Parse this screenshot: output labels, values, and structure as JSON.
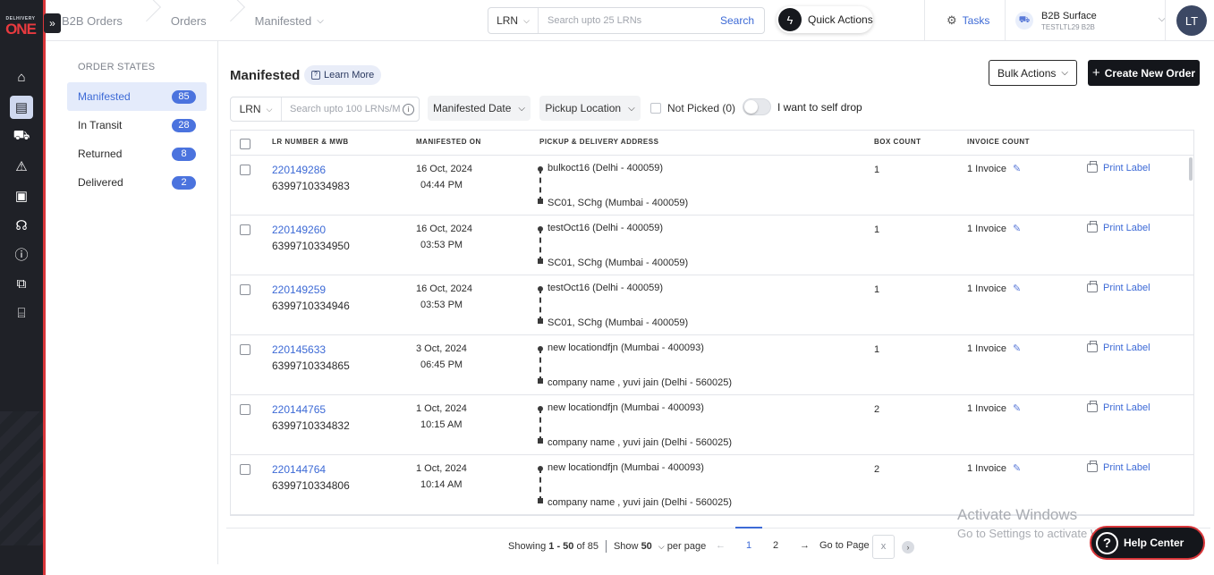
{
  "brand": {
    "small": "DELHIVERY",
    "big": "ONE"
  },
  "rail": {
    "icons": [
      "home-icon",
      "orders-icon",
      "truck-icon",
      "warning-icon",
      "payments-icon",
      "support-icon",
      "info-icon",
      "apps-icon",
      "warehouse-icon"
    ],
    "active_index": 1
  },
  "breadcrumb": [
    "B2B Orders",
    "Orders",
    "Manifested"
  ],
  "search": {
    "type": "LRN",
    "placeholder": "Search upto 25 LRNs",
    "button": "Search"
  },
  "quick_actions": "Quick Actions",
  "tasks": "Tasks",
  "account": {
    "name": "B2B Surface",
    "sub": "TESTLTL29 B2B",
    "avatar": "LT"
  },
  "order_states": {
    "title": "ORDER STATES",
    "items": [
      {
        "label": "Manifested",
        "count": "85"
      },
      {
        "label": "In Transit",
        "count": "28"
      },
      {
        "label": "Returned",
        "count": "8"
      },
      {
        "label": "Delivered",
        "count": "2"
      }
    ]
  },
  "page": {
    "title": "Manifested",
    "learn_more": "Learn More",
    "bulk_actions": "Bulk Actions",
    "create_order": "Create New Order"
  },
  "filters": {
    "lrn_type": "LRN",
    "lrn_placeholder": "Search upto 100 LRNs/M",
    "manifested_date": "Manifested Date",
    "pickup_location": "Pickup Location",
    "not_picked": "Not Picked (0)",
    "self_drop": "I want to self drop"
  },
  "table": {
    "headers": {
      "lr": "LR NUMBER & MWB",
      "manifested": "MANIFESTED ON",
      "address": "PICKUP & DELIVERY ADDRESS",
      "box": "BOX COUNT",
      "invoice": "INVOICE COUNT"
    },
    "rows": [
      {
        "lrn": "220149286",
        "mwb": "6399710334983",
        "date": "16 Oct, 2024",
        "time": "04:44 PM",
        "pickup": "bulkoct16 (Delhi - 400059)",
        "delivery": "SC01, SChg (Mumbai - 400059)",
        "box": "1",
        "invoice": "1 Invoice",
        "print": "Print Label"
      },
      {
        "lrn": "220149260",
        "mwb": "6399710334950",
        "date": "16 Oct, 2024",
        "time": "03:53 PM",
        "pickup": "testOct16 (Delhi - 400059)",
        "delivery": "SC01, SChg (Mumbai - 400059)",
        "box": "1",
        "invoice": "1 Invoice",
        "print": "Print Label"
      },
      {
        "lrn": "220149259",
        "mwb": "6399710334946",
        "date": "16 Oct, 2024",
        "time": "03:53 PM",
        "pickup": "testOct16 (Delhi - 400059)",
        "delivery": "SC01, SChg (Mumbai - 400059)",
        "box": "1",
        "invoice": "1 Invoice",
        "print": "Print Label"
      },
      {
        "lrn": "220145633",
        "mwb": "6399710334865",
        "date": "3 Oct, 2024",
        "time": "06:45 PM",
        "pickup": "new locationdfjn (Mumbai - 400093)",
        "delivery": "company name , yuvi jain (Delhi - 560025)",
        "box": "1",
        "invoice": "1 Invoice",
        "print": "Print Label"
      },
      {
        "lrn": "220144765",
        "mwb": "6399710334832",
        "date": "1 Oct, 2024",
        "time": "10:15 AM",
        "pickup": "new locationdfjn (Mumbai - 400093)",
        "delivery": "company name , yuvi jain (Delhi - 560025)",
        "box": "2",
        "invoice": "1 Invoice",
        "print": "Print Label"
      },
      {
        "lrn": "220144764",
        "mwb": "6399710334806",
        "date": "1 Oct, 2024",
        "time": "10:14 AM",
        "pickup": "new locationdfjn (Mumbai - 400093)",
        "delivery": "company name , yuvi jain (Delhi - 560025)",
        "box": "2",
        "invoice": "1 Invoice",
        "print": "Print Label"
      }
    ]
  },
  "pagination": {
    "showing_prefix": "Showing",
    "range": "1 - 50",
    "of_label": "of",
    "total": "85",
    "show_label": "Show",
    "page_size": "50",
    "per_page": "per page",
    "pages": [
      "1",
      "2"
    ],
    "current": "1",
    "goto_label": "Go to Page",
    "goto_placeholder": "x"
  },
  "watermark": {
    "line1": "Activate Windows",
    "line2": "Go to Settings to activate Windows."
  },
  "help": "Help Center",
  "colors": {
    "accent": "#3d6ad6",
    "rail": "#1f2127",
    "brand_red": "#e83a3f",
    "badge": "#4b73de"
  }
}
